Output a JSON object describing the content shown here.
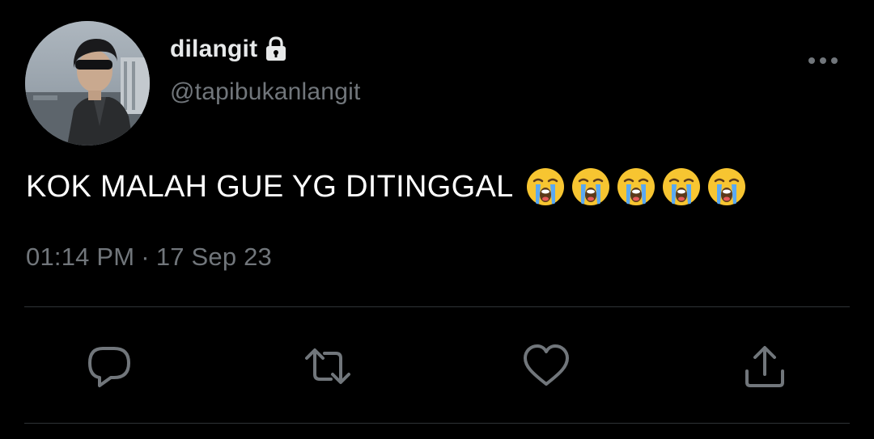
{
  "user": {
    "display_name": "dilangit",
    "handle": "@tapibukanlangit",
    "protected_icon": "lock-icon",
    "avatar": "profile-photo"
  },
  "tweet": {
    "text": "KOK MALAH GUE YG DITINGGAL",
    "emojis": [
      "loudly-crying-face",
      "loudly-crying-face",
      "loudly-crying-face",
      "loudly-crying-face",
      "loudly-crying-face"
    ],
    "time": "01:14 PM",
    "separator": "·",
    "date": "17 Sep 23"
  },
  "menu": {
    "icon": "more-horizontal-icon"
  },
  "actions": [
    {
      "name": "reply",
      "icon": "reply-icon"
    },
    {
      "name": "retweet",
      "icon": "retweet-icon"
    },
    {
      "name": "like",
      "icon": "heart-icon"
    },
    {
      "name": "share",
      "icon": "share-icon"
    }
  ],
  "colors": {
    "background": "#000000",
    "text_primary": "#ffffff",
    "text_secondary": "#71767b",
    "divider": "#2f3336"
  }
}
